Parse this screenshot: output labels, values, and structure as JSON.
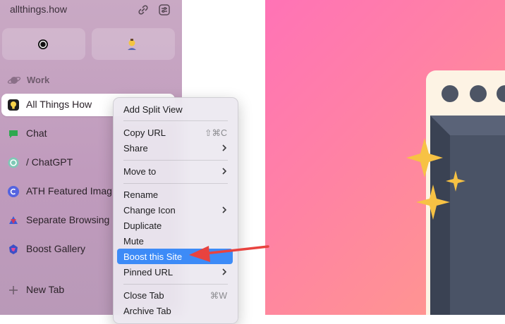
{
  "sidebar": {
    "url": "allthings.how",
    "space_label": "Work",
    "tabs": [
      {
        "label": "All Things How",
        "icon": "bulb-icon"
      },
      {
        "label": "Chat",
        "icon": "chat-icon"
      },
      {
        "label": "/ ChatGPT",
        "icon": "chatgpt-icon"
      },
      {
        "label": "ATH Featured Imag",
        "icon": "canva-icon"
      },
      {
        "label": "Separate Browsing",
        "icon": "app-icon"
      },
      {
        "label": "Boost Gallery",
        "icon": "boost-icon"
      }
    ],
    "new_tab_label": "New Tab",
    "colors": {
      "sidebar": "#c5a3c1",
      "active_tab": "#ffffff"
    }
  },
  "context_menu": {
    "items": [
      {
        "label": "Add Split View"
      },
      {
        "label": "Copy URL",
        "shortcut": "⇧⌘C"
      },
      {
        "label": "Share"
      },
      {
        "label": "Move to"
      },
      {
        "label": "Rename"
      },
      {
        "label": "Change Icon"
      },
      {
        "label": "Duplicate"
      },
      {
        "label": "Mute"
      },
      {
        "label": "Boost this Site",
        "highlighted": true
      },
      {
        "label": "Pinned URL"
      },
      {
        "label": "Close Tab",
        "shortcut": "⌘W"
      },
      {
        "label": "Archive Tab"
      }
    ],
    "highlight_color": "#3d8bf7"
  },
  "annotation": {
    "arrow_color": "#e8433f"
  }
}
